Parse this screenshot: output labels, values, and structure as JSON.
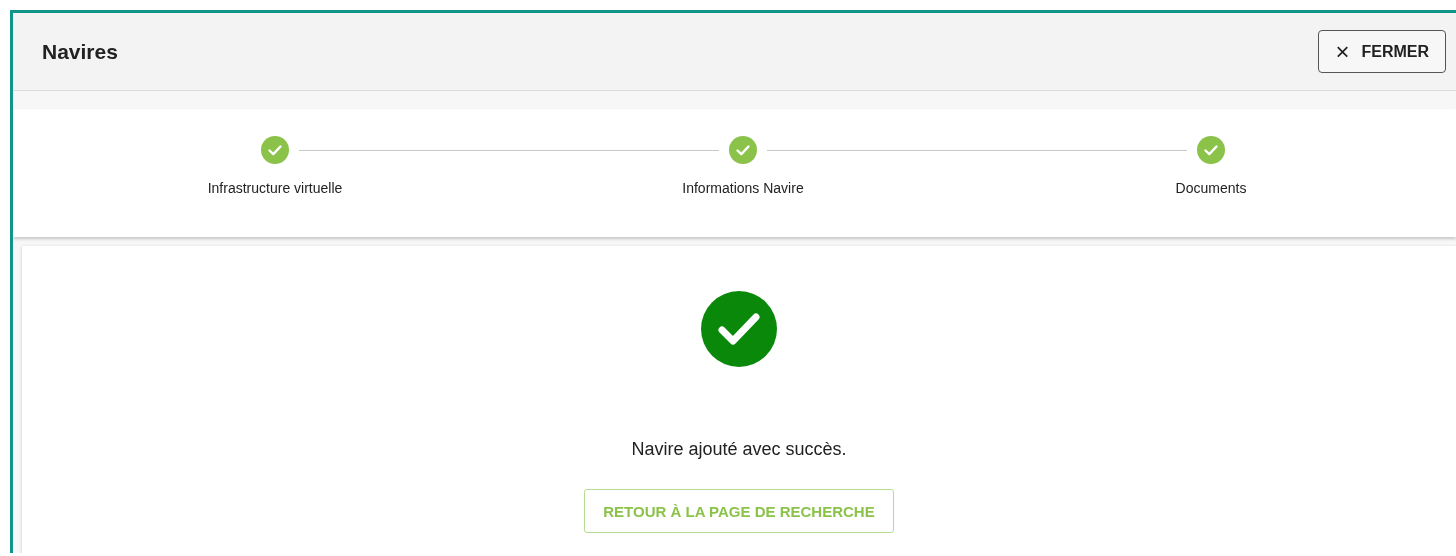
{
  "header": {
    "title": "Navires",
    "close_button": {
      "icon": "×",
      "label": "FERMER"
    }
  },
  "steps": [
    {
      "label": "Infrastructure virtuelle",
      "completed": true
    },
    {
      "label": "Informations Navire",
      "completed": true
    },
    {
      "label": "Documents",
      "completed": true
    }
  ],
  "result": {
    "message": "Navire ajouté avec succès.",
    "button": "RETOUR À LA PAGE DE RECHERCHE"
  }
}
